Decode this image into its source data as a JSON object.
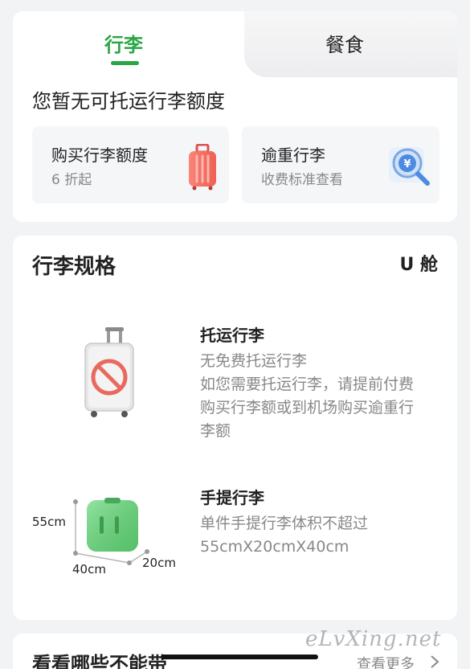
{
  "tabs": [
    {
      "label": "行李",
      "active": true
    },
    {
      "label": "餐食",
      "active": false
    }
  ],
  "quota": {
    "title": "您暂无可托运行李额度",
    "buy": {
      "title": "购买行李额度",
      "subtitle": "6 折起",
      "icon": "red-suitcase-icon"
    },
    "overweight": {
      "title": "逾重行李",
      "subtitle": "收费标准查看",
      "icon": "yen-search-icon"
    }
  },
  "spec": {
    "title": "行李规格",
    "cabin": "U 舱",
    "checked": {
      "title": "托运行李",
      "lines": [
        "无免费托运行李",
        "如您需要托运行李，请提前付费",
        "购买行李额或到机场购买逾重行",
        "李额"
      ],
      "icon": "no-checked-bag-icon"
    },
    "carry_on": {
      "title": "手提行李",
      "lines": [
        "单件手提行李体积不超过",
        "55cmX20cmX40cm"
      ],
      "dims": {
        "height": "55cm",
        "width": "40cm",
        "depth": "20cm"
      },
      "icon": "carry-on-suitcase-icon"
    }
  },
  "bans": {
    "title": "看看哪些不能带",
    "more": "查看更多"
  },
  "watermark": "eLvXing.net",
  "colors": {
    "accent": "#2aa646",
    "muted": "#888888",
    "background": "#f2f3f5"
  }
}
